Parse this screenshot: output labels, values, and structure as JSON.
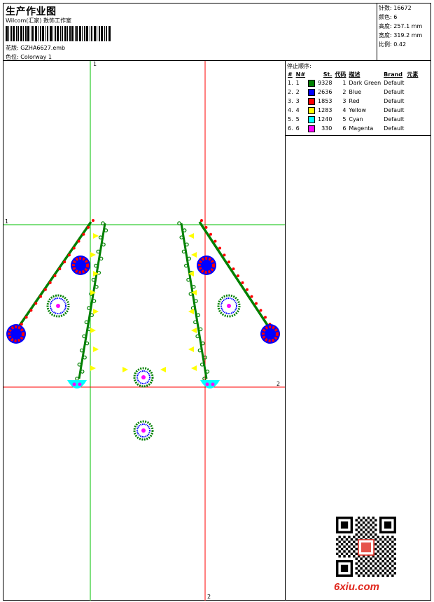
{
  "header": {
    "title": "生产作业图",
    "studio": "Wilcom(汇家) 数饰工作室",
    "design_label": "花版:",
    "design_value": "GZHA6627.emb",
    "colorway_label": "色位:",
    "colorway_value": "Colorway 1"
  },
  "stats": [
    {
      "label": "针数:",
      "value": "16672"
    },
    {
      "label": "颜色:",
      "value": "6"
    },
    {
      "label": "高度:",
      "value": "257.1 mm"
    },
    {
      "label": "宽度:",
      "value": "319.2 mm"
    },
    {
      "label": "比例:",
      "value": "0.42"
    }
  ],
  "stop_sequence": {
    "title": "停止顺序:",
    "columns": [
      "#",
      "N#",
      "St.",
      "代码",
      "描述",
      "Brand",
      "元素"
    ],
    "rows": [
      {
        "num": "1.",
        "n": "1",
        "color": "#008000",
        "st": "9328",
        "code": "1",
        "desc": "Dark Green",
        "brand": "Default"
      },
      {
        "num": "2.",
        "n": "2",
        "color": "#0000ff",
        "st": "2636",
        "code": "2",
        "desc": "Blue",
        "brand": "Default"
      },
      {
        "num": "3.",
        "n": "3",
        "color": "#ff0000",
        "st": "1853",
        "code": "3",
        "desc": "Red",
        "brand": "Default"
      },
      {
        "num": "4.",
        "n": "4",
        "color": "#ffff00",
        "st": "1283",
        "code": "4",
        "desc": "Yellow",
        "brand": "Default"
      },
      {
        "num": "5.",
        "n": "5",
        "color": "#00ffff",
        "st": "1240",
        "code": "5",
        "desc": "Cyan",
        "brand": "Default"
      },
      {
        "num": "6.",
        "n": "6",
        "color": "#ff00ff",
        "st": "330",
        "code": "6",
        "desc": "Magenta",
        "brand": "Default"
      }
    ]
  },
  "axes": {
    "v1_label": "1",
    "h1_label": "1",
    "v2_label": "2",
    "h2_label": "2"
  },
  "colors": {
    "green_guide": "#00c000",
    "red_guide": "#ff0000",
    "dark_green": "#008000",
    "blue": "#0000ff",
    "red": "#ff0000",
    "yellow": "#ffff00",
    "cyan": "#00ffff",
    "magenta": "#ff00ff"
  },
  "watermark": {
    "text": "6xiu.com",
    "stamp_icon": "seal-stamp-icon",
    "qr_icon": "qr-code-icon"
  }
}
